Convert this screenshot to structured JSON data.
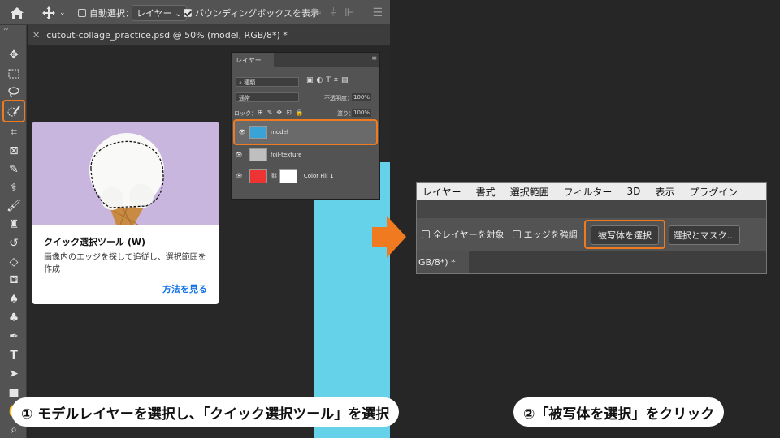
{
  "options_bar": {
    "auto_select_label": "自動選択：",
    "layer_select": "レイヤー",
    "bounding_box_label": "バウンディングボックスを表示"
  },
  "document": {
    "tab_title": "cutout-collage_practice.psd @ 50% (model, RGB/8*) *"
  },
  "tooltip_card": {
    "title": "クイック選択ツール (W)",
    "description": "画像内のエッジを探して追従し、選択範囲を作成",
    "link": "方法を見る"
  },
  "layers_panel": {
    "tab": "レイヤー",
    "kind_filter": "種類",
    "blend_mode": "通常",
    "opacity_label": "不透明度：",
    "opacity_value": "100%",
    "lock_label": "ロック：",
    "fill_label": "塗り：",
    "fill_value": "100%",
    "layers": [
      {
        "name": "model"
      },
      {
        "name": "foil-texture"
      },
      {
        "name": "Color Fill 1"
      }
    ]
  },
  "menu_bar": {
    "items": [
      "レイヤー",
      "書式",
      "選択範囲",
      "フィルター",
      "3D",
      "表示",
      "プラグイン"
    ],
    "all_layers_label": "全レイヤーを対象",
    "enhance_edge_label": "エッジを強調",
    "select_subject_button": "被写体を選択",
    "select_mask_button": "選択とマスク...",
    "tab_fragment": "GB/8*) *"
  },
  "banners": {
    "step1": "① モデルレイヤーを選択し、「クイック選択ツール」を選択",
    "step2": "②「被写体を選択」をクリック"
  },
  "colors": {
    "highlight": "#f07a1f",
    "link": "#1473e6",
    "canvas_cyan": "#66d2ea"
  }
}
